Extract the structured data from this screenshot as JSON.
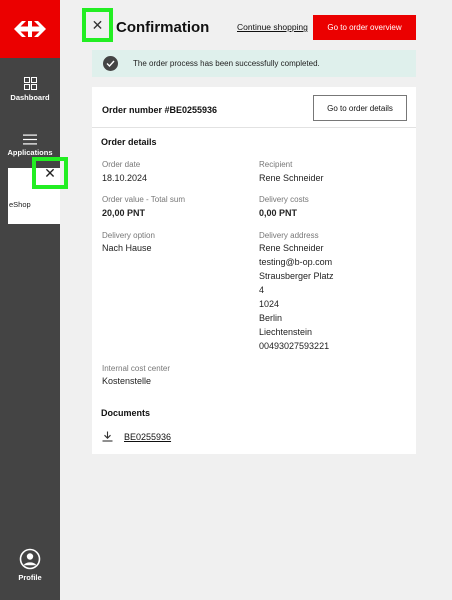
{
  "sidebar": {
    "brand_color": "#eb0000",
    "logo_icon": "sbb-logo",
    "items": [
      {
        "label": "Dashboard",
        "icon": "grid-icon"
      },
      {
        "label": "Applications",
        "icon": "menu-icon"
      }
    ],
    "open_app": {
      "label": "eShop",
      "close_icon": "close-icon"
    },
    "profile": {
      "label": "Profile",
      "icon": "user-circle-icon"
    }
  },
  "header": {
    "close_icon": "close-icon",
    "title": "Confirmation",
    "continue_link": "Continue shopping",
    "overview_button": "Go to order overview"
  },
  "banner": {
    "icon": "check-circle-icon",
    "text": "The order process has been successfully completed.",
    "background": "#dff0ec"
  },
  "order": {
    "number": "Order number #BE0255936",
    "details_button": "Go to order details",
    "section_title": "Order details",
    "order_date_label": "Order date",
    "order_date": "18.10.2024",
    "recipient_label": "Recipient",
    "recipient": "Rene Schneider",
    "order_value_label": "Order value - Total sum",
    "order_value": "20,00 PNT",
    "delivery_costs_label": "Delivery costs",
    "delivery_costs": "0,00 PNT",
    "delivery_option_label": "Delivery option",
    "delivery_option": "Nach Hause",
    "delivery_address_label": "Delivery address",
    "delivery_address": [
      "Rene Schneider",
      "testing@b-op.com",
      "Strausberger Platz",
      "4",
      "1024",
      "Berlin",
      "Liechtenstein",
      "00493027593221"
    ],
    "cost_center_label": "Internal cost center",
    "cost_center": "Kostenstelle",
    "documents_title": "Documents",
    "documents": [
      {
        "name": "BE0255936",
        "icon": "download-icon"
      }
    ]
  }
}
